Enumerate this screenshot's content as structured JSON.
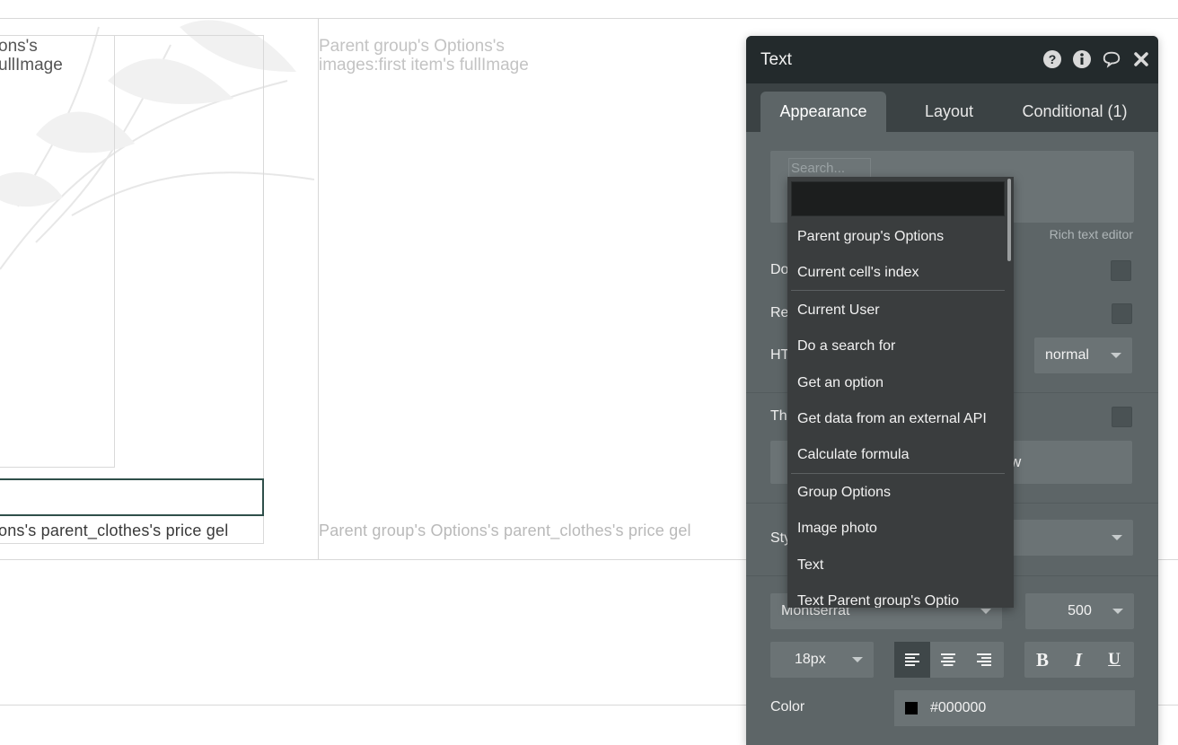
{
  "canvas": {
    "card_image_label": [
      "ons's",
      "ullImage"
    ],
    "image_placeholder": [
      "Parent group's Options's",
      "images:first item's fullImage"
    ],
    "card_price": "ons's parent_clothes's price gel",
    "price_placeholder": "Parent group's Options's parent_clothes's price gel"
  },
  "panel": {
    "title": "Text",
    "icons": [
      "help-icon",
      "info-icon",
      "comment-icon",
      "close-icon"
    ],
    "tabs": [
      {
        "label": "Appearance",
        "active": true
      },
      {
        "label": "Layout",
        "active": false
      },
      {
        "label": "Conditional (1)",
        "active": false
      }
    ],
    "search_placeholder": "Search...",
    "rich_text_label": "Rich text editor",
    "row_labels": {
      "do": "Do",
      "re": "Re",
      "ht": "HT",
      "th": "Th",
      "sty": "Sty"
    },
    "html_tag_value": "normal",
    "wide_button_fragment": "w",
    "font_family": "Montserrat",
    "font_weight": "500",
    "font_size": "18px",
    "color_label": "Color",
    "color_value": "#000000",
    "style_buttons": {
      "bold": "B",
      "italic": "I",
      "underline": "U"
    }
  },
  "dropdown": {
    "items": [
      "Parent group's Options",
      "Current cell's index",
      "Current User",
      "Do a search for",
      "Get an option",
      "Get data from an external API",
      "Calculate formula",
      "Group Options",
      "Image photo",
      "Text",
      "Text Parent group's Optio"
    ]
  },
  "colors": {
    "panel_header": "#232a2c",
    "panel_body": "#5d6567",
    "dropdown_bg": "#3a3d3e",
    "swatch": "#000000"
  }
}
